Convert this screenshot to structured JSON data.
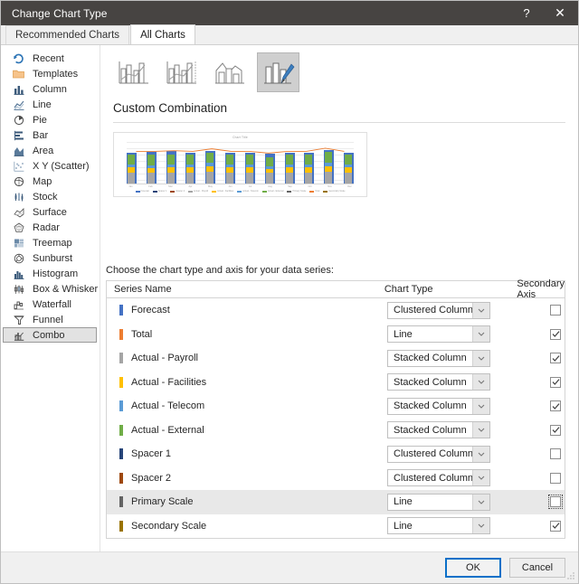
{
  "window": {
    "title": "Change Chart Type",
    "help_label": "?",
    "close_label": "✕"
  },
  "tabs": [
    {
      "label": "Recommended Charts",
      "active": false
    },
    {
      "label": "All Charts",
      "active": true
    }
  ],
  "sidebar": {
    "items": [
      {
        "label": "Recent",
        "icon": "recent-icon",
        "selected": false
      },
      {
        "label": "Templates",
        "icon": "templates-icon",
        "selected": false
      },
      {
        "label": "Column",
        "icon": "column-icon",
        "selected": false
      },
      {
        "label": "Line",
        "icon": "line-icon",
        "selected": false
      },
      {
        "label": "Pie",
        "icon": "pie-icon",
        "selected": false
      },
      {
        "label": "Bar",
        "icon": "bar-icon",
        "selected": false
      },
      {
        "label": "Area",
        "icon": "area-icon",
        "selected": false
      },
      {
        "label": "X Y (Scatter)",
        "icon": "scatter-icon",
        "selected": false
      },
      {
        "label": "Map",
        "icon": "map-icon",
        "selected": false
      },
      {
        "label": "Stock",
        "icon": "stock-icon",
        "selected": false
      },
      {
        "label": "Surface",
        "icon": "surface-icon",
        "selected": false
      },
      {
        "label": "Radar",
        "icon": "radar-icon",
        "selected": false
      },
      {
        "label": "Treemap",
        "icon": "treemap-icon",
        "selected": false
      },
      {
        "label": "Sunburst",
        "icon": "sunburst-icon",
        "selected": false
      },
      {
        "label": "Histogram",
        "icon": "histogram-icon",
        "selected": false
      },
      {
        "label": "Box & Whisker",
        "icon": "box-whisker-icon",
        "selected": false
      },
      {
        "label": "Waterfall",
        "icon": "waterfall-icon",
        "selected": false
      },
      {
        "label": "Funnel",
        "icon": "funnel-icon",
        "selected": false
      },
      {
        "label": "Combo",
        "icon": "combo-icon",
        "selected": true
      }
    ]
  },
  "thumbnails": [
    {
      "name": "clustered-column-line",
      "selected": false
    },
    {
      "name": "clustered-column-line-secondary-axis",
      "selected": false
    },
    {
      "name": "stacked-area-clustered-column",
      "selected": false
    },
    {
      "name": "custom-combination",
      "selected": true
    }
  ],
  "main": {
    "heading": "Custom Combination",
    "choose_text": "Choose the chart type and axis for your data series:"
  },
  "preview": {
    "chart_title": "Chart Title",
    "y_axis_left": [
      "7.0",
      "6.0",
      "5.0",
      "4.0",
      "3.0",
      "2.0",
      "1.0",
      "0.0"
    ],
    "y_axis_right": [
      "6.0",
      "5.0",
      "4.0",
      "3.0",
      "2.0",
      "1.0",
      "0.0"
    ],
    "categories": [
      "Jan",
      "Feb",
      "Mar",
      "Apr",
      "May",
      "Jun",
      "Jul",
      "Aug",
      "Sep",
      "Oct",
      "Nov",
      "Dec"
    ],
    "legend": [
      "Forecast",
      "Spacer 1",
      "Spacer 2",
      "Actual - Payroll",
      "Actual - Facilities",
      "Actual - Telecom",
      "Actual - External",
      "Primary Scale",
      "Total",
      "Secondary Scale"
    ]
  },
  "table": {
    "headers": {
      "series_name": "Series Name",
      "chart_type": "Chart Type",
      "secondary_axis": "Secondary Axis"
    },
    "rows": [
      {
        "name": "Forecast",
        "color": "#4472c4",
        "type": "Clustered Column",
        "secondary": false,
        "highlight": false,
        "focused": false
      },
      {
        "name": "Total",
        "color": "#ed7d31",
        "type": "Line",
        "secondary": true,
        "highlight": false,
        "focused": false
      },
      {
        "name": "Actual - Payroll",
        "color": "#a5a5a5",
        "type": "Stacked Column",
        "secondary": true,
        "highlight": false,
        "focused": false
      },
      {
        "name": "Actual - Facilities",
        "color": "#ffc000",
        "type": "Stacked Column",
        "secondary": true,
        "highlight": false,
        "focused": false
      },
      {
        "name": "Actual - Telecom",
        "color": "#5b9bd5",
        "type": "Stacked Column",
        "secondary": true,
        "highlight": false,
        "focused": false
      },
      {
        "name": "Actual - External",
        "color": "#70ad47",
        "type": "Stacked Column",
        "secondary": true,
        "highlight": false,
        "focused": false
      },
      {
        "name": "Spacer 1",
        "color": "#264478",
        "type": "Clustered Column",
        "secondary": false,
        "highlight": false,
        "focused": false
      },
      {
        "name": "Spacer 2",
        "color": "#9e480e",
        "type": "Clustered Column",
        "secondary": false,
        "highlight": false,
        "focused": false
      },
      {
        "name": "Primary Scale",
        "color": "#636363",
        "type": "Line",
        "secondary": false,
        "highlight": true,
        "focused": true
      },
      {
        "name": "Secondary Scale",
        "color": "#997300",
        "type": "Line",
        "secondary": true,
        "highlight": false,
        "focused": false
      }
    ]
  },
  "footer": {
    "ok_label": "OK",
    "cancel_label": "Cancel"
  },
  "chart_data": {
    "type": "bar",
    "title": "Chart Title",
    "categories": [
      "Jan",
      "Feb",
      "Mar",
      "Apr",
      "May",
      "Jun",
      "Jul",
      "Aug",
      "Sep",
      "Oct",
      "Nov",
      "Dec"
    ],
    "series": [
      {
        "name": "Forecast",
        "color": "#4472c4",
        "values": [
          5.0,
          5.1,
          5.2,
          5.0,
          5.3,
          4.9,
          5.0,
          4.8,
          5.0,
          5.0,
          5.4,
          4.9
        ]
      },
      {
        "name": "Actual - Payroll",
        "color": "#a5a5a5",
        "values": [
          1.8,
          1.7,
          1.8,
          1.8,
          1.9,
          1.8,
          1.8,
          1.7,
          1.8,
          1.8,
          1.9,
          1.8
        ]
      },
      {
        "name": "Actual - Facilities",
        "color": "#ffc000",
        "values": [
          0.8,
          0.8,
          0.9,
          0.8,
          0.9,
          0.8,
          0.8,
          0.7,
          0.8,
          0.8,
          0.9,
          0.8
        ]
      },
      {
        "name": "Actual - Telecom",
        "color": "#5b9bd5",
        "values": [
          0.4,
          0.4,
          0.4,
          0.4,
          0.5,
          0.4,
          0.4,
          0.4,
          0.4,
          0.4,
          0.5,
          0.4
        ]
      },
      {
        "name": "Actual - External",
        "color": "#70ad47",
        "values": [
          1.6,
          1.7,
          1.6,
          1.6,
          1.7,
          1.6,
          1.6,
          1.5,
          1.6,
          1.6,
          1.8,
          1.6
        ]
      },
      {
        "name": "Total",
        "color": "#ed7d31",
        "values": [
          4.6,
          4.6,
          4.7,
          4.6,
          5.0,
          4.6,
          4.6,
          4.3,
          4.6,
          4.6,
          5.1,
          4.6
        ]
      }
    ],
    "ylabel": "",
    "xlabel": "",
    "ylim": [
      0,
      7
    ],
    "grid": true,
    "legend_position": "bottom"
  }
}
